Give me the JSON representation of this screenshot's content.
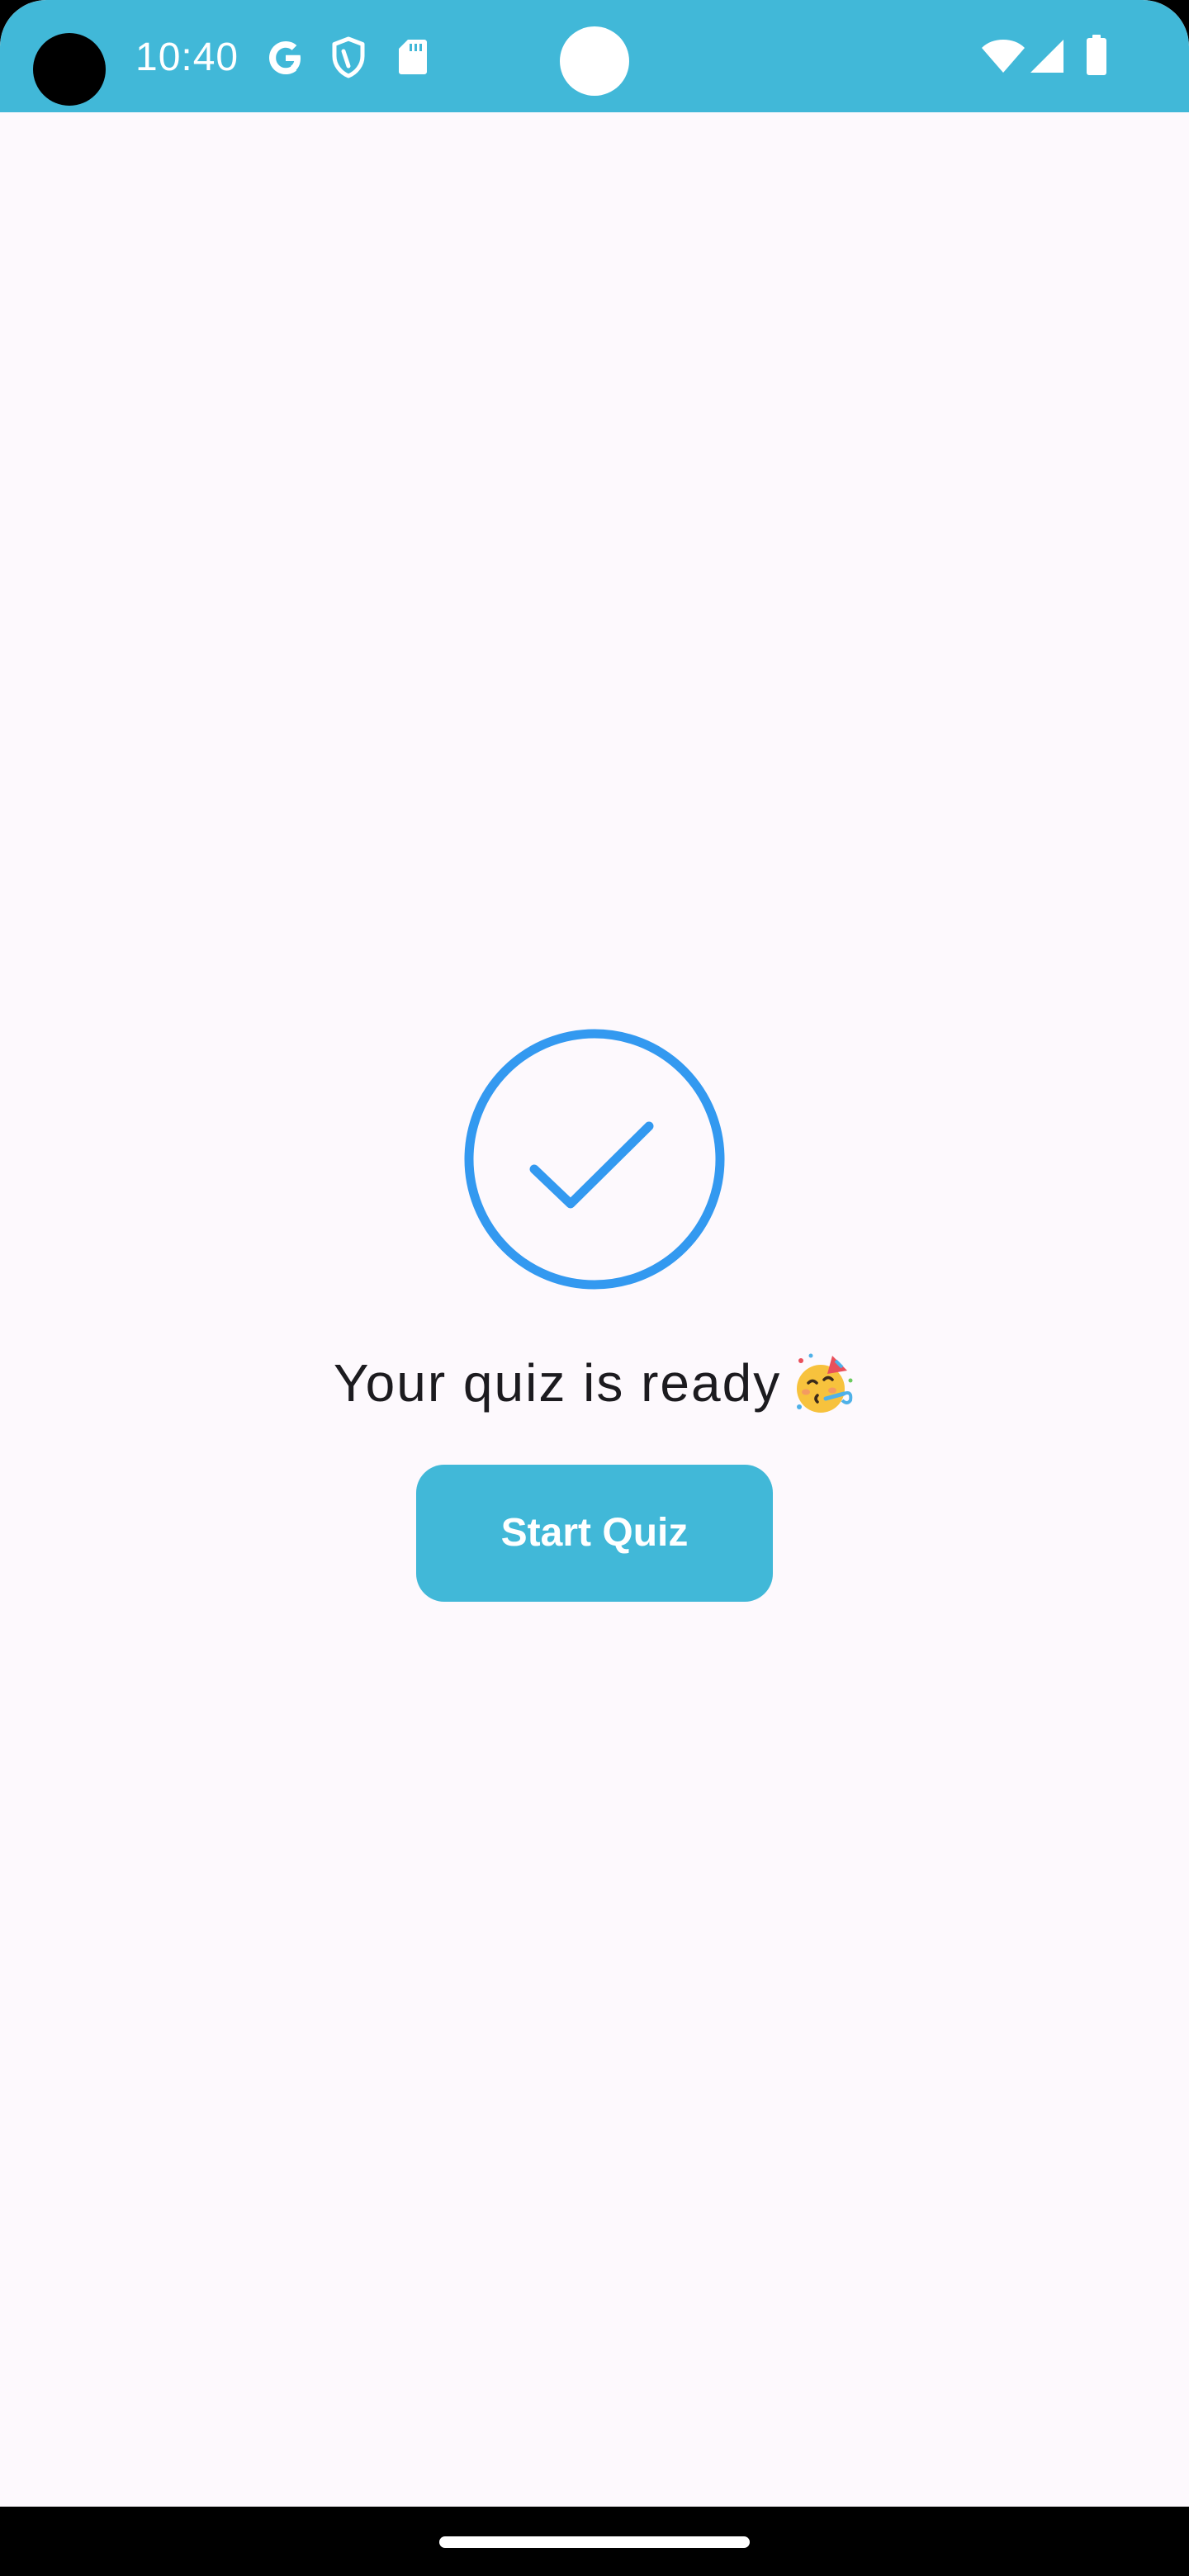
{
  "status_bar": {
    "time": "10:40",
    "background_color": "#41b8d8",
    "left_icons": [
      "google-icon",
      "shield-icon",
      "sd-card-icon"
    ],
    "right_icons": [
      "wifi-icon",
      "cell-signal-icon",
      "battery-icon"
    ]
  },
  "main": {
    "check_icon": "check-circle-icon",
    "check_color": "#3399f0",
    "message": "Your quiz is ready",
    "message_emoji": "party-face-emoji",
    "start_button_label": "Start Quiz",
    "accent_color": "#41b8d8"
  },
  "nav_bar": {
    "handle": "home-handle"
  }
}
